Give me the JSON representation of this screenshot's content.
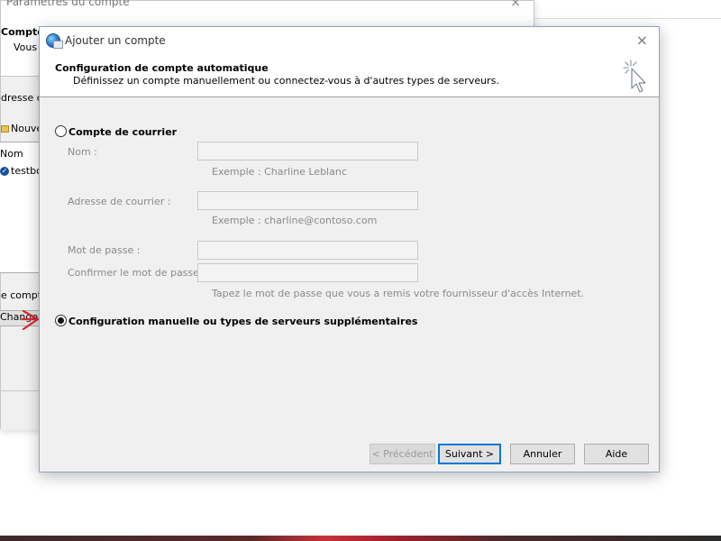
{
  "background_window": {
    "title": "Paramètres du compte",
    "close_glyph": "×",
    "header_title": "Comptes",
    "header_subtitle": "Vous p",
    "address_label": "dresse de",
    "new_button": "Nouve",
    "list_header": "Nom",
    "list_row": "testbo",
    "account_label": "e compte",
    "change_button": "Changer"
  },
  "dialog": {
    "title": "Ajouter un compte",
    "close_glyph": "×",
    "header": {
      "title": "Configuration de compte automatique",
      "subtitle": "Définissez un compte manuellement ou connectez-vous à d'autres types de serveurs."
    },
    "option_email": {
      "label": "Compte de courrier",
      "selected": false
    },
    "fields": {
      "name_label": "Nom :",
      "name_value": "",
      "name_hint": "Exemple : Charline Leblanc",
      "email_label": "Adresse de courrier :",
      "email_value": "",
      "email_hint": "Exemple : charline@contoso.com",
      "password_label": "Mot de passe :",
      "password_value": "",
      "confirm_label": "Confirmer le mot de passe :",
      "confirm_value": "",
      "password_hint": "Tapez le mot de passe que vous a remis votre fournisseur d'accès Internet."
    },
    "option_manual": {
      "label": "Configuration manuelle ou types de serveurs supplémentaires",
      "selected": true
    },
    "buttons": {
      "previous": "< Précédent",
      "next": "Suivant >",
      "cancel": "Annuler",
      "help": "Aide"
    }
  },
  "colors": {
    "annotation_arrow": "#d9282f",
    "accent": "#0078d7"
  }
}
